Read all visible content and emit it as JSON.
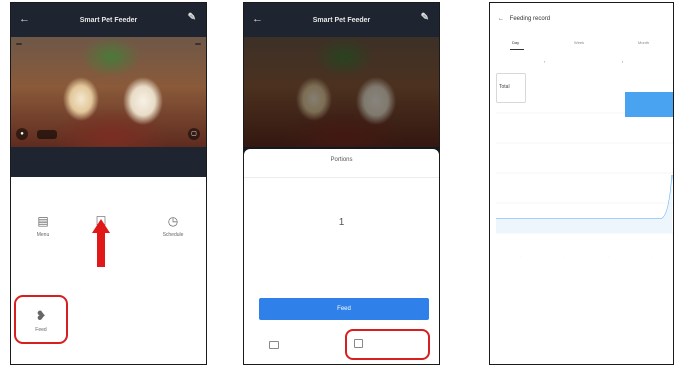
{
  "screens": {
    "home": {
      "title": "Smart Pet Feeder",
      "back_icon": "back-arrow-icon",
      "menu_icon": "pencil-icon",
      "video": {
        "tag_left": "",
        "tag_right": "",
        "pill": ""
      },
      "controls": [
        {
          "icon": "menu-icon",
          "label": "Menu"
        },
        {
          "icon": "feed-icon",
          "label": ""
        },
        {
          "icon": "clock-icon",
          "label": "Schedule"
        }
      ],
      "feed_shortcut": {
        "icon": "feed-icon",
        "label": "Feed"
      },
      "annotation": {
        "arrow_color": "#e01818",
        "box_color": "#d62020"
      }
    },
    "portions": {
      "title": "Portions",
      "value": "1",
      "note": "",
      "feed_button": "Feed",
      "option_left": "",
      "option_right": ""
    },
    "record": {
      "title": "Feeding record",
      "back_icon": "back-arrow-icon",
      "tabs": [
        "Day",
        "Week",
        "Month"
      ],
      "active_tab": 0,
      "date": "",
      "tooltip_left": {
        "line1": "",
        "line2": "Total",
        "line3": ""
      },
      "tooltip_right": {
        "line1": "",
        "line2": ""
      }
    }
  },
  "colors": {
    "accent_blue": "#2f80e8",
    "annotation_red": "#d62020",
    "header_dark": "#1e2530",
    "chart_line": "#4aa3f0"
  }
}
